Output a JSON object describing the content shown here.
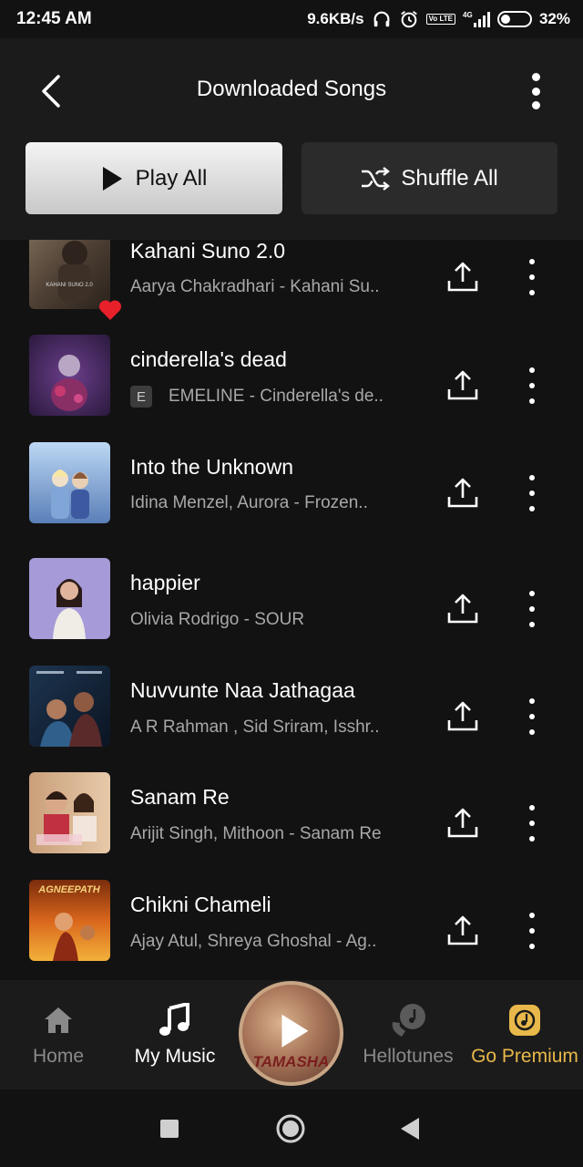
{
  "status_bar": {
    "time": "12:45 AM",
    "network_speed": "9.6KB/s",
    "battery_percent": "32%",
    "battery_level": 0.32,
    "icons": [
      "headphones-icon",
      "alarm-icon",
      "volte-icon",
      "signal-icon",
      "battery-icon"
    ],
    "volte_label": "Vo LTE",
    "network_type": "4G"
  },
  "header": {
    "title": "Downloaded Songs",
    "back_icon": "chevron-left-icon",
    "more_icon": "more-vertical-icon"
  },
  "actions": {
    "play_all_label": "Play All",
    "shuffle_all_label": "Shuffle All"
  },
  "songs": [
    {
      "title": "Kahani Suno 2.0",
      "subtitle": "Aarya Chakradhari - Kahani Su..",
      "explicit": false,
      "liked": true,
      "art_caption": "KAHANI SUNO 2.0"
    },
    {
      "title": "cinderella's dead",
      "subtitle": "EMELINE - Cinderella's de..",
      "explicit": true,
      "explicit_label": "E"
    },
    {
      "title": "Into the Unknown",
      "subtitle": "Idina Menzel, Aurora - Frozen..",
      "explicit": false
    },
    {
      "title": "happier",
      "subtitle": "Olivia Rodrigo - SOUR",
      "explicit": false
    },
    {
      "title": "Nuvvunte Naa Jathagaa",
      "subtitle": "A R Rahman , Sid Sriram, Isshr..",
      "explicit": false
    },
    {
      "title": "Sanam Re",
      "subtitle": "Arijit Singh, Mithoon - Sanam Re",
      "explicit": false
    },
    {
      "title": "Chikni Chameli",
      "subtitle": "Ajay Atul, Shreya Ghoshal - Ag..",
      "explicit": false,
      "art_caption": "AGNEEPATH"
    }
  ],
  "bottom_nav": {
    "items": [
      {
        "label": "Home",
        "icon": "home-icon",
        "active": false
      },
      {
        "label": "My Music",
        "icon": "music-note-icon",
        "active": true
      },
      {
        "label": "Hellotunes",
        "icon": "hellotunes-icon",
        "active": false
      },
      {
        "label": "Go Premium",
        "icon": "premium-icon",
        "active": false
      }
    ],
    "now_playing_text": "TAMASHA"
  },
  "colors": {
    "background": "#121212",
    "header_bg": "#1b1b1b",
    "premium_gold": "#e9b84a",
    "heart_red": "#e8202a",
    "secondary_text": "#a8a8a8"
  }
}
